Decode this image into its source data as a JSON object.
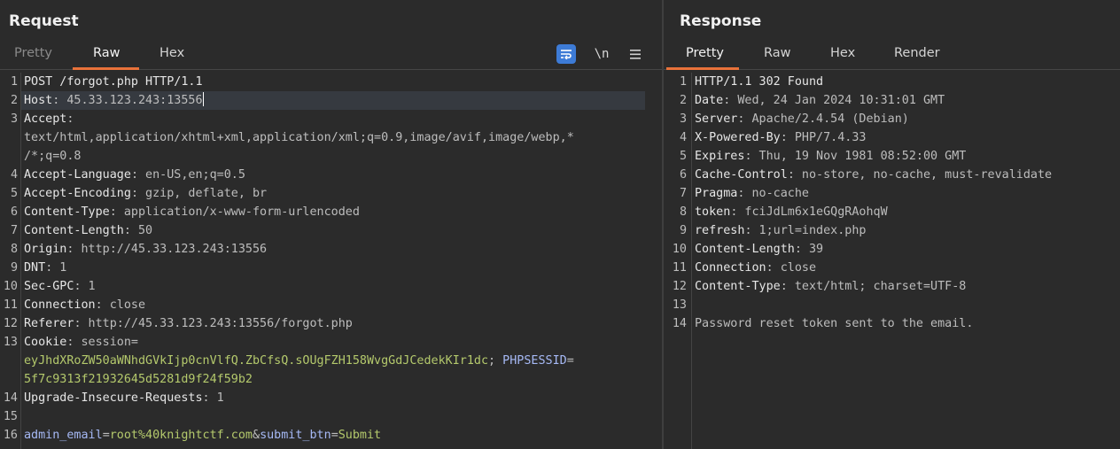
{
  "request": {
    "title": "Request",
    "tabs": {
      "pretty": "Pretty",
      "raw": "Raw",
      "hex": "Hex"
    },
    "tools": {
      "newline": "\\n"
    },
    "lines": [
      {
        "num": "1",
        "parts": [
          {
            "t": "POST /forgot.php HTTP/1.1",
            "c": "k"
          }
        ]
      },
      {
        "num": "2",
        "parts": [
          {
            "t": "Host",
            "c": "k"
          },
          {
            "t": ": 45.33.123.243:13556",
            "c": "v"
          }
        ],
        "caret": true
      },
      {
        "num": "3",
        "parts": [
          {
            "t": "Accept",
            "c": "k"
          },
          {
            "t": ":",
            "c": "v"
          }
        ]
      },
      {
        "num": "",
        "parts": [
          {
            "t": "text/html,application/xhtml+xml,application/xml;q=0.9,image/avif,image/webp,*",
            "c": "v"
          }
        ]
      },
      {
        "num": "",
        "parts": [
          {
            "t": "/*;q=0.8",
            "c": "v"
          }
        ]
      },
      {
        "num": "4",
        "parts": [
          {
            "t": "Accept-Language",
            "c": "k"
          },
          {
            "t": ": en-US,en;q=0.5",
            "c": "v"
          }
        ]
      },
      {
        "num": "5",
        "parts": [
          {
            "t": "Accept-Encoding",
            "c": "k"
          },
          {
            "t": ": gzip, deflate, br",
            "c": "v"
          }
        ]
      },
      {
        "num": "6",
        "parts": [
          {
            "t": "Content-Type",
            "c": "k"
          },
          {
            "t": ": application/x-www-form-urlencoded",
            "c": "v"
          }
        ]
      },
      {
        "num": "7",
        "parts": [
          {
            "t": "Content-Length",
            "c": "k"
          },
          {
            "t": ": 50",
            "c": "v"
          }
        ]
      },
      {
        "num": "8",
        "parts": [
          {
            "t": "Origin",
            "c": "k"
          },
          {
            "t": ": http://45.33.123.243:13556",
            "c": "v"
          }
        ]
      },
      {
        "num": "9",
        "parts": [
          {
            "t": "DNT",
            "c": "k"
          },
          {
            "t": ": 1",
            "c": "v"
          }
        ]
      },
      {
        "num": "10",
        "parts": [
          {
            "t": "Sec-GPC",
            "c": "k"
          },
          {
            "t": ": 1",
            "c": "v"
          }
        ]
      },
      {
        "num": "11",
        "parts": [
          {
            "t": "Connection",
            "c": "k"
          },
          {
            "t": ": close",
            "c": "v"
          }
        ]
      },
      {
        "num": "12",
        "parts": [
          {
            "t": "Referer",
            "c": "k"
          },
          {
            "t": ": http://45.33.123.243:13556/forgot.php",
            "c": "v"
          }
        ]
      },
      {
        "num": "13",
        "parts": [
          {
            "t": "Cookie",
            "c": "k"
          },
          {
            "t": ": session=",
            "c": "v"
          }
        ]
      },
      {
        "num": "",
        "parts": [
          {
            "t": "eyJhdXRoZW50aWNhdGVkIjp0cnVlfQ.ZbCfsQ.sOUgFZH158WvgGdJCedekKIr1dc",
            "c": "g"
          },
          {
            "t": "; ",
            "c": "v"
          },
          {
            "t": "PHPSESSID",
            "c": "b"
          },
          {
            "t": "=",
            "c": "v"
          }
        ]
      },
      {
        "num": "",
        "parts": [
          {
            "t": "5f7c9313f21932645d5281d9f24f59b2",
            "c": "g"
          }
        ]
      },
      {
        "num": "14",
        "parts": [
          {
            "t": "Upgrade-Insecure-Requests",
            "c": "k"
          },
          {
            "t": ": 1",
            "c": "v"
          }
        ]
      },
      {
        "num": "15",
        "parts": []
      },
      {
        "num": "16",
        "parts": [
          {
            "t": "admin_email",
            "c": "b"
          },
          {
            "t": "=",
            "c": "v"
          },
          {
            "t": "root%40knightctf.com",
            "c": "g"
          },
          {
            "t": "&",
            "c": "v"
          },
          {
            "t": "submit_btn",
            "c": "b"
          },
          {
            "t": "=",
            "c": "v"
          },
          {
            "t": "Submit",
            "c": "g"
          }
        ]
      }
    ]
  },
  "response": {
    "title": "Response",
    "tabs": {
      "pretty": "Pretty",
      "raw": "Raw",
      "hex": "Hex",
      "render": "Render"
    },
    "lines": [
      {
        "num": "1",
        "parts": [
          {
            "t": "HTTP/1.1 302 Found",
            "c": "k"
          }
        ]
      },
      {
        "num": "2",
        "parts": [
          {
            "t": "Date",
            "c": "k"
          },
          {
            "t": ": Wed, 24 Jan 2024 10:31:01 GMT",
            "c": "v"
          }
        ]
      },
      {
        "num": "3",
        "parts": [
          {
            "t": "Server",
            "c": "k"
          },
          {
            "t": ": Apache/2.4.54 (Debian)",
            "c": "v"
          }
        ]
      },
      {
        "num": "4",
        "parts": [
          {
            "t": "X-Powered-By",
            "c": "k"
          },
          {
            "t": ": PHP/7.4.33",
            "c": "v"
          }
        ]
      },
      {
        "num": "5",
        "parts": [
          {
            "t": "Expires",
            "c": "k"
          },
          {
            "t": ": Thu, 19 Nov 1981 08:52:00 GMT",
            "c": "v"
          }
        ]
      },
      {
        "num": "6",
        "parts": [
          {
            "t": "Cache-Control",
            "c": "k"
          },
          {
            "t": ": no-store, no-cache, must-revalidate",
            "c": "v"
          }
        ]
      },
      {
        "num": "7",
        "parts": [
          {
            "t": "Pragma",
            "c": "k"
          },
          {
            "t": ": no-cache",
            "c": "v"
          }
        ]
      },
      {
        "num": "8",
        "parts": [
          {
            "t": "token",
            "c": "k"
          },
          {
            "t": ": fciJdLm6x1eGQgRAohqW",
            "c": "v"
          }
        ]
      },
      {
        "num": "9",
        "parts": [
          {
            "t": "refresh",
            "c": "k"
          },
          {
            "t": ": 1;url=index.php",
            "c": "v"
          }
        ]
      },
      {
        "num": "10",
        "parts": [
          {
            "t": "Content-Length",
            "c": "k"
          },
          {
            "t": ": 39",
            "c": "v"
          }
        ]
      },
      {
        "num": "11",
        "parts": [
          {
            "t": "Connection",
            "c": "k"
          },
          {
            "t": ": close",
            "c": "v"
          }
        ]
      },
      {
        "num": "12",
        "parts": [
          {
            "t": "Content-Type",
            "c": "k"
          },
          {
            "t": ": text/html; charset=UTF-8",
            "c": "v"
          }
        ]
      },
      {
        "num": "13",
        "parts": []
      },
      {
        "num": "14",
        "parts": [
          {
            "t": "Password reset token sent to the email.",
            "c": "v"
          }
        ]
      }
    ]
  },
  "colors": {
    "background": "#2b2b2b",
    "accent_tab": "#e8723a",
    "wrap_button": "#3d7bd6",
    "header_key": "#e6e6e6",
    "header_value": "#bdbdbd",
    "param_value": "#b4c96c",
    "param_name": "#a6b9f5"
  },
  "icons": {
    "wrap": "word-wrap-icon",
    "newline": "show-newlines-icon",
    "menu": "hamburger-menu-icon"
  }
}
